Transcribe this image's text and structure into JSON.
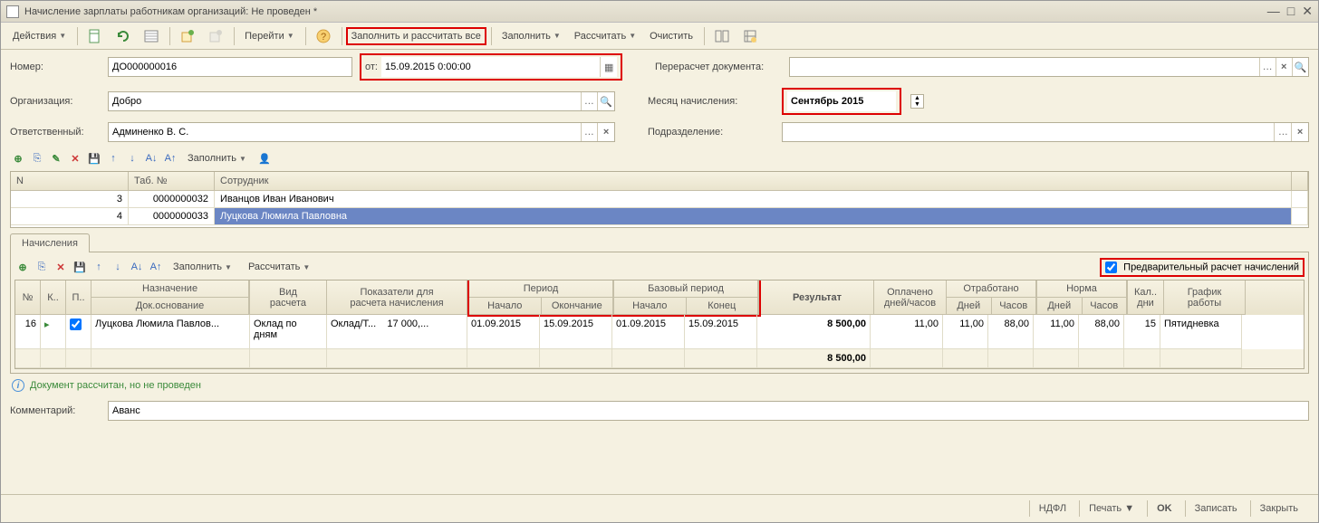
{
  "window": {
    "title": "Начисление зарплаты работникам организаций: Не проведен *"
  },
  "toolbar": {
    "actions": "Действия",
    "goto": "Перейти",
    "fill_calc_all": "Заполнить и рассчитать все",
    "fill": "Заполнить",
    "calc": "Рассчитать",
    "clear": "Очистить"
  },
  "form": {
    "number_label": "Номер:",
    "number": "ДО000000016",
    "date_label": "от:",
    "date": "15.09.2015 0:00:00",
    "org_label": "Организация:",
    "org": "Добро",
    "resp_label": "Ответственный:",
    "resp": "Админенко В. С.",
    "recalc_label": "Перерасчет документа:",
    "month_label": "Месяц начисления:",
    "month": "Сентябрь 2015",
    "division_label": "Подразделение:"
  },
  "employees": {
    "fill": "Заполнить",
    "headers": {
      "n": "N",
      "tab": "Таб. №",
      "emp": "Сотрудник"
    },
    "rows": [
      {
        "n": "3",
        "tab": "0000000032",
        "emp": "Иванцов Иван Иванович"
      },
      {
        "n": "4",
        "tab": "0000000033",
        "emp": "Луцкова Люмила Павловна"
      }
    ]
  },
  "tabs": {
    "accruals": "Начисления"
  },
  "accruals": {
    "fill": "Заполнить",
    "calc": "Рассчитать",
    "preliminary": "Предварительный расчет начислений",
    "headers": {
      "no": "№",
      "k": "К..",
      "p": "П..",
      "assign": "Назначение",
      "docbase": "Док.основание",
      "calctype": "Вид\nрасчета",
      "indicators": "Показатели для\nрасчета начисления",
      "period": "Период",
      "period_start": "Начало",
      "period_end": "Окончание",
      "base_period": "Базовый период",
      "base_start": "Начало",
      "base_end": "Конец",
      "result": "Результат",
      "paid": "Оплачено\nдней/часов",
      "worked": "Отработано",
      "days": "Дней",
      "hours": "Часов",
      "norm": "Норма",
      "cal": "Кал..\nдни",
      "schedule": "График\nработы"
    },
    "row": {
      "no": "16",
      "assign": "Луцкова Люмила Павлов...",
      "calctype": "Оклад по дням",
      "indic_name": "Оклад/Т...",
      "indic_val": "17 000,...",
      "p_start": "01.09.2015",
      "p_end": "15.09.2015",
      "b_start": "01.09.2015",
      "b_end": "15.09.2015",
      "result": "8 500,00",
      "paid": "11,00",
      "w_days": "11,00",
      "w_hours": "88,00",
      "n_days": "11,00",
      "n_hours": "88,00",
      "cal": "15",
      "schedule": "Пятидневка"
    },
    "total": "8 500,00"
  },
  "status": "Документ рассчитан, но не проведен",
  "comment_label": "Комментарий:",
  "comment": "Аванс",
  "footer": {
    "ndfl": "НДФЛ",
    "print": "Печать",
    "ok": "OK",
    "save": "Записать",
    "close": "Закрыть"
  }
}
